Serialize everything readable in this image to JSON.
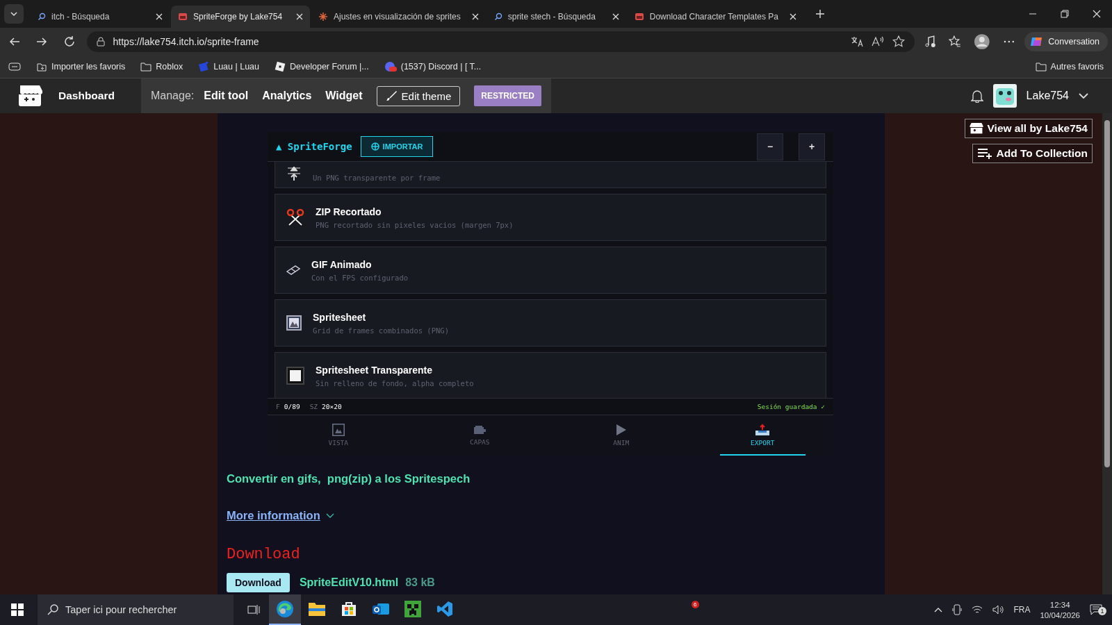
{
  "browser": {
    "tabs": [
      {
        "title": "itch - Búsqueda",
        "selected": false,
        "kind": "search"
      },
      {
        "title": "SpriteForge by Lake754",
        "selected": true,
        "kind": "store"
      },
      {
        "title": "Ajustes en visualización de sprites",
        "selected": false,
        "kind": "spark"
      },
      {
        "title": "sprite stech - Búsqueda",
        "selected": false,
        "kind": "search"
      },
      {
        "title": "Download Character Templates Pa",
        "selected": false,
        "kind": "store"
      }
    ],
    "address": "https://lake754.itch.io/sprite-frame",
    "conversation": "Conversation",
    "bookmarks": [
      {
        "label": "Importer les favoris",
        "kind": "import"
      },
      {
        "label": "Roblox",
        "kind": "folder"
      },
      {
        "label": "Luau | Luau",
        "kind": "square"
      },
      {
        "label": "Developer Forum |...",
        "kind": "tilted"
      },
      {
        "label": "(1537) Discord | [ T...",
        "kind": "chat"
      }
    ],
    "other_bookmarks": "Autres favoris"
  },
  "itch_bar": {
    "dashboard": "Dashboard",
    "manage": "Manage:",
    "links": [
      "Edit tool",
      "Analytics",
      "Widget"
    ],
    "edit_theme": "Edit theme",
    "restricted": "RESTRICTED",
    "user": "Lake754"
  },
  "side_buttons": [
    "View all by Lake754",
    "Add To Collection"
  ],
  "app": {
    "title": "▲ SpriteForge",
    "import": "IMPORTAR",
    "zoom_out": "−",
    "zoom_in": "+",
    "export_options": [
      {
        "kind": "frames",
        "subtitle": "Un PNG transparente por frame"
      },
      {
        "kind": "scissors",
        "title": "ZIP Recortado",
        "subtitle": "PNG recortado sin pixeles vacios (margen 7px)"
      },
      {
        "kind": "film",
        "title": "GIF Animado",
        "subtitle": "Con el FPS configurado"
      },
      {
        "kind": "sheet",
        "title": "Spritesheet",
        "subtitle": "Grid de frames combinados (PNG)"
      },
      {
        "kind": "blank",
        "title": "Spritesheet Transparente",
        "subtitle": "Sin relleno de fondo, alpha completo"
      }
    ],
    "status": {
      "frame_label": "F",
      "frame": "0/89",
      "size_label": "SZ",
      "size": "20×20",
      "saved": "Sesión guardada ✓"
    },
    "nav": [
      {
        "label": "VISTA",
        "kind": "sheet",
        "selected": false
      },
      {
        "label": "CAPAS",
        "kind": "layers",
        "selected": false
      },
      {
        "label": "ANIM",
        "kind": "play",
        "selected": false
      },
      {
        "label": "EXPORT",
        "kind": "export",
        "selected": true
      }
    ]
  },
  "page": {
    "description": "Convertir en gifs,  png(zip) a los Spritespech",
    "more_info": "More information",
    "download_heading": "Download",
    "download_button": "Download",
    "file_name": "SpriteEditV10.html",
    "file_size": "83 kB"
  },
  "taskbar": {
    "search_placeholder": "Taper ici pour rechercher",
    "apps": [
      {
        "kind": "browser",
        "selected": true
      },
      {
        "kind": "folder",
        "selected": false
      },
      {
        "kind": "store",
        "selected": false
      },
      {
        "kind": "mail",
        "selected": false
      },
      {
        "kind": "block",
        "selected": false
      },
      {
        "kind": "code",
        "selected": false
      }
    ],
    "badge": "6",
    "language": "FRA",
    "time": "12:34",
    "date": "10/04/2026",
    "notifications": "1"
  }
}
